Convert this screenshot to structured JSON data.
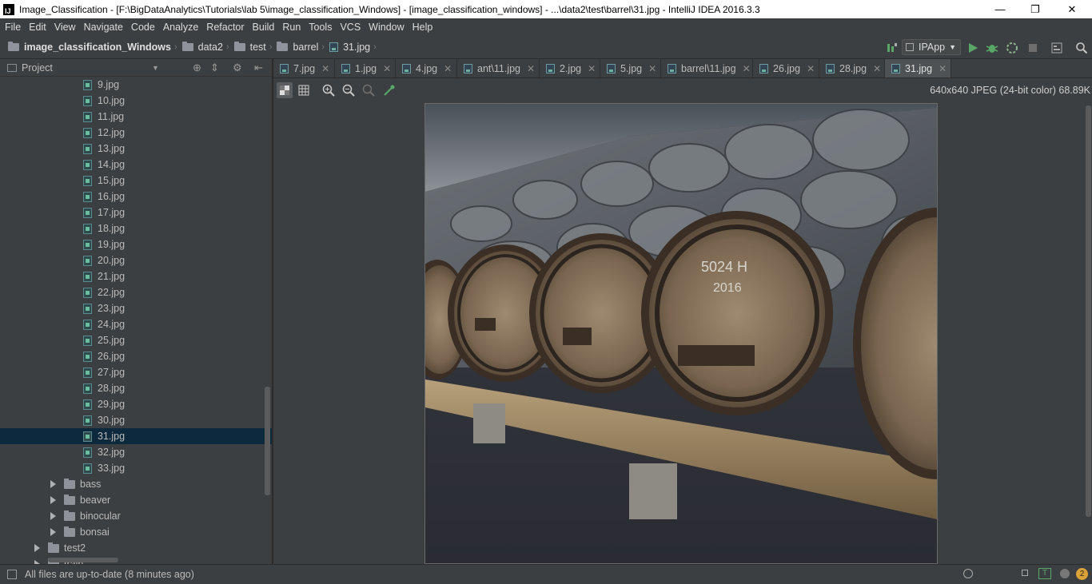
{
  "window": {
    "title": "Image_Classification - [F:\\BigDataAnalytics\\Tutorials\\lab 5\\image_classification_Windows] - [image_classification_windows] - ...\\data2\\test\\barrel\\31.jpg - IntelliJ IDEA 2016.3.3",
    "app_icon_text": "IJ",
    "minimize": "—",
    "restore": "❐",
    "close": "✕"
  },
  "menu": [
    "File",
    "Edit",
    "View",
    "Navigate",
    "Code",
    "Analyze",
    "Refactor",
    "Build",
    "Run",
    "Tools",
    "VCS",
    "Window",
    "Help"
  ],
  "breadcrumb": [
    {
      "label": "image_classification_Windows",
      "icon": "project-folder-icon"
    },
    {
      "label": "data2",
      "icon": "folder-icon"
    },
    {
      "label": "test",
      "icon": "folder-icon"
    },
    {
      "label": "barrel",
      "icon": "folder-icon"
    },
    {
      "label": "31.jpg",
      "icon": "image-file-icon"
    }
  ],
  "toolbar": {
    "run_config": "IPApp",
    "colors": {
      "run": "#59a869",
      "debug": "#59a869",
      "stop": "#6e6e6e"
    }
  },
  "project_panel": {
    "title": "Project",
    "files": [
      "9.jpg",
      "10.jpg",
      "11.jpg",
      "12.jpg",
      "13.jpg",
      "14.jpg",
      "15.jpg",
      "16.jpg",
      "17.jpg",
      "18.jpg",
      "19.jpg",
      "20.jpg",
      "21.jpg",
      "22.jpg",
      "23.jpg",
      "24.jpg",
      "25.jpg",
      "26.jpg",
      "27.jpg",
      "28.jpg",
      "29.jpg",
      "30.jpg",
      "31.jpg",
      "32.jpg",
      "33.jpg"
    ],
    "selected_file": "31.jpg",
    "folders": [
      "bass",
      "beaver",
      "binocular",
      "bonsai"
    ],
    "sibling_folder": "test2",
    "partial_folder": "train"
  },
  "tabs": [
    {
      "label": "7.jpg",
      "active": false
    },
    {
      "label": "1.jpg",
      "active": false
    },
    {
      "label": "4.jpg",
      "active": false
    },
    {
      "label": "ant\\11.jpg",
      "active": false
    },
    {
      "label": "2.jpg",
      "active": false
    },
    {
      "label": "5.jpg",
      "active": false
    },
    {
      "label": "barrel\\11.jpg",
      "active": false
    },
    {
      "label": "26.jpg",
      "active": false
    },
    {
      "label": "28.jpg",
      "active": false
    },
    {
      "label": "31.jpg",
      "active": true
    }
  ],
  "image_viewer": {
    "info": "640x640 JPEG (24-bit color) 68.89K",
    "tools": [
      "background-grid-icon",
      "chessboard-icon",
      "zoom-in-icon",
      "zoom-out-icon",
      "actual-size-icon",
      "color-picker-icon"
    ],
    "barrel_chalk_text": "5024 H",
    "barrel_chalk_text_2": "2016"
  },
  "status": {
    "message": "All files are up-to-date (8 minutes ago)",
    "notification_count": "2"
  }
}
